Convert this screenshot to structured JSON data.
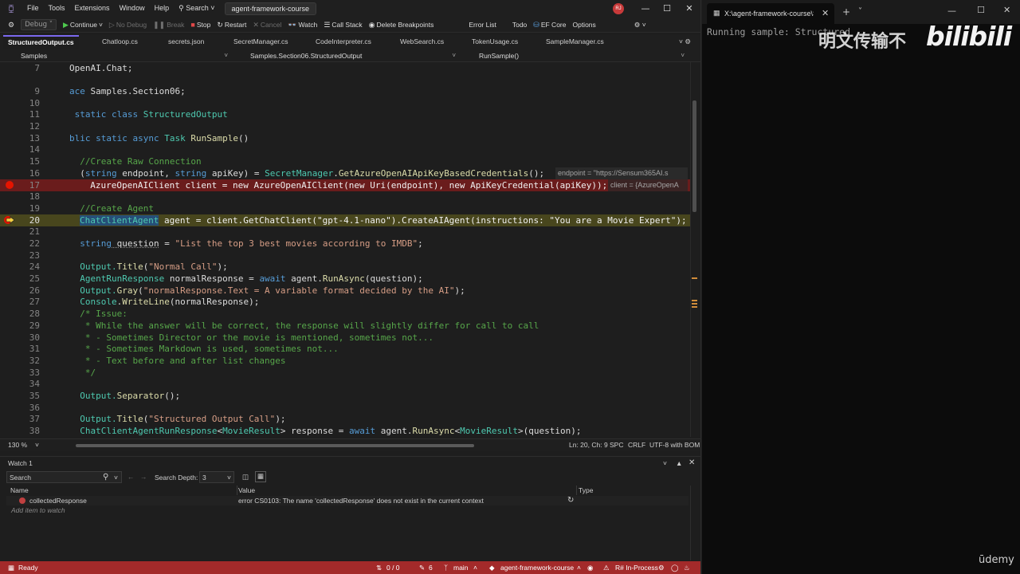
{
  "menubar": {
    "items": [
      "File",
      "Tools",
      "Extensions",
      "Window",
      "Help"
    ],
    "search_label": "Search",
    "solution": "agent-framework-course",
    "user_initials": "RJ"
  },
  "toolbar": {
    "config": "Debug",
    "continue": "Continue",
    "no_debug": "No Debug",
    "break": "Break",
    "stop": "Stop",
    "restart": "Restart",
    "cancel": "Cancel",
    "watch": "Watch",
    "call_stack": "Call Stack",
    "delete_breakpoints": "Delete Breakpoints",
    "error_list": "Error List",
    "todo": "Todo",
    "ef_core": "EF Core",
    "options": "Options"
  },
  "tabs": [
    "StructuredOutput.cs",
    "Chatloop.cs",
    "secrets.json",
    "SecretManager.cs",
    "CodeInterpreter.cs",
    "WebSearch.cs",
    "TokenUsage.cs",
    "SampleManager.cs"
  ],
  "navbar": {
    "project": "Samples",
    "type": "Samples.Section06.StructuredOutput",
    "member": "RunSample()"
  },
  "editor": {
    "line_numbers": [
      "7",
      "9",
      "10",
      "11",
      "12",
      "13",
      "14",
      "15",
      "16",
      "17",
      "18",
      "19",
      "20",
      "21",
      "22",
      "23",
      "24",
      "25",
      "26",
      "27",
      "28",
      "29",
      "30",
      "31",
      "32",
      "33",
      "34",
      "35",
      "36",
      "37",
      "38"
    ],
    "hint_endpoint": "endpoint = \"https://Sensum365AI.s",
    "hint_client": "client = {AzureOpenA",
    "lines": {
      "l7": "OpenAI.Chat;",
      "l9a": "ace",
      "l9b": " Samples.Section06;",
      "l11a": " static",
      "l11b": " class",
      "l11c": " StructuredOutput",
      "l13a": "blic",
      "l13b": " static",
      "l13c": " async",
      "l13d": " Task",
      "l13e": " RunSample",
      "l13f": "()",
      "l15": "  //Create Raw Connection",
      "l16a": "  (",
      "l16b": "string",
      "l16c": " endpoint, ",
      "l16d": "string",
      "l16e": " apiKey) = ",
      "l16f": "SecretManager",
      "l16g": ".",
      "l16h": "GetAzureOpenAIApiKeyBasedCredentials",
      "l16i": "();",
      "l17": "  AzureOpenAIClient client = new AzureOpenAIClient(new Uri(endpoint), new ApiKeyCredential(apiKey));",
      "l19": "  //Create Agent",
      "l20a": "ChatClientAgent",
      "l20b": " agent = client.GetChatClient(\"gpt-4.1-nano\").CreateAIAgent(instructions: \"You are a Movie Expert\");",
      "l22a": "  ",
      "l22b": "string",
      "l22c": " question",
      "l22d": " = ",
      "l22e": "\"List the top 3 best movies according to IMDB\"",
      "l22f": ";",
      "l24a": "  Output.",
      "l24b": "Title",
      "l24c": "(",
      "l24d": "\"Normal Call\"",
      "l24e": ");",
      "l25a": "  ",
      "l25b": "AgentRunResponse",
      "l25c": " normalResponse",
      "l25d": " = ",
      "l25e": "await",
      "l25f": " agent.",
      "l25g": "RunAsync",
      "l25h": "(question);",
      "l26a": "  Output.",
      "l26b": "Gray",
      "l26c": "(",
      "l26d": "\"normalResponse.Text = A variable format decided by the AI\"",
      "l26e": ");",
      "l27a": "  ",
      "l27b": "Console",
      "l27c": ".",
      "l27d": "WriteLine",
      "l27e": "(normalResponse);",
      "l28": "  /* Issue:",
      "l29": "   * While the answer will be correct, the response will slightly differ for call to call",
      "l30": "   * - Sometimes Director or the movie is mentioned, sometimes not...",
      "l31": "   * - Sometimes Markdown is used, sometimes not...",
      "l32": "   * - Text before and after list changes",
      "l33": "   */",
      "l35a": "  Output.",
      "l35b": "Separator",
      "l35c": "();",
      "l37a": "  Output.",
      "l37b": "Title",
      "l37c": "(",
      "l37d": "\"Structured Output Call\"",
      "l37e": ");",
      "l38a": "  ",
      "l38b": "ChatClientAgentRunResponse",
      "l38c": "<",
      "l38d": "MovieResult",
      "l38e": ">",
      "l38f": " response",
      "l38g": " = ",
      "l38h": "await",
      "l38i": " agent.",
      "l38j": "RunAsync",
      "l38k": "<",
      "l38l": "MovieResult",
      "l38m": ">(question);"
    }
  },
  "editor_status": {
    "zoom": "130 %",
    "position": "Ln: 20, Ch: 9",
    "spc": "SPC",
    "crlf": "CRLF",
    "encoding": "UTF-8 with BOM"
  },
  "watch": {
    "title": "Watch 1",
    "search_placeholder": "Search",
    "search_depth_label": "Search Depth:",
    "search_depth": "3",
    "col_name": "Name",
    "col_value": "Value",
    "col_type": "Type",
    "row_name": "collectedResponse",
    "row_value": "error CS0103: The name 'collectedResponse' does not exist in the current context",
    "add_item": "Add item to watch"
  },
  "statusbar": {
    "state": "Ready",
    "changes": "0 / 0",
    "edits": "6",
    "branch": "main",
    "repo": "agent-framework-course",
    "resharper": "R# In-Process"
  },
  "terminal": {
    "tab_title": "X:\\agent-framework-course\\S",
    "output": "Running sample: Structured",
    "watermark_cn": "明文传输不",
    "watermark_logo": "bilibili",
    "watermark_udemy": "ūdemy"
  },
  "colors": {
    "accent": "#7b68ee",
    "statusbar": "#a32a2a",
    "breakpoint": "#e51400"
  }
}
